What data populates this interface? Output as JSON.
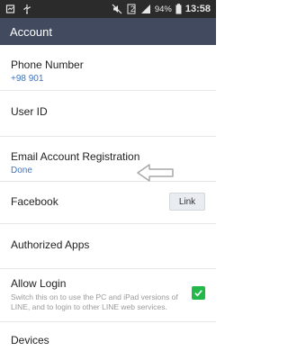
{
  "status_bar": {
    "battery": "94%",
    "time": "13:58",
    "sim_number": "2",
    "icons": [
      "notification-icon",
      "usb-icon",
      "mute-icon",
      "signal-icon",
      "battery-icon"
    ]
  },
  "appbar": {
    "title": "Account"
  },
  "rows": {
    "phone": {
      "label": "Phone Number",
      "value": "+98 901"
    },
    "user_id": {
      "label": "User ID"
    },
    "email": {
      "label": "Email Account Registration",
      "value": "Done"
    },
    "facebook": {
      "label": "Facebook",
      "button": "Link"
    },
    "authorized": {
      "label": "Authorized Apps"
    },
    "allow_login": {
      "label": "Allow Login",
      "description": "Switch this on to use the PC and iPad versions of LINE, and to login to other LINE web services.",
      "checked": true
    },
    "devices": {
      "label": "Devices"
    }
  },
  "colors": {
    "appbar": "#414a5f",
    "statusbar": "#2b2b2b",
    "accent_link": "#3f74bf",
    "checkbox": "#22b94a"
  }
}
